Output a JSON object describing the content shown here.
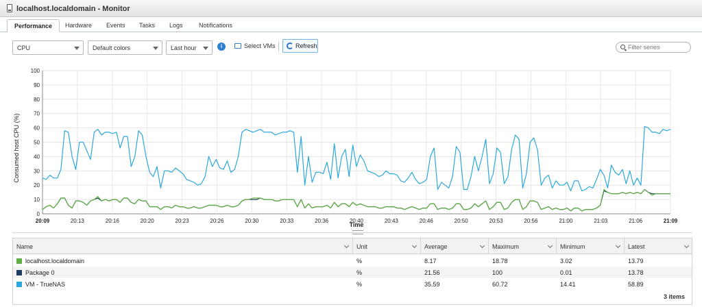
{
  "window": {
    "title": "localhost.localdomain - Monitor",
    "icon": "host-icon"
  },
  "tabs": [
    {
      "label": "Performance",
      "active": true
    },
    {
      "label": "Hardware"
    },
    {
      "label": "Events"
    },
    {
      "label": "Tasks"
    },
    {
      "label": "Logs"
    },
    {
      "label": "Notifications"
    }
  ],
  "toolbar": {
    "metric_select": "CPU",
    "colors_select": "Default colors",
    "period_select": "Last hour",
    "info_icon": "info-icon",
    "select_vms_label": "Select VMs",
    "refresh_label": "Refresh",
    "filter_placeholder": "Filter series"
  },
  "chart_data": {
    "type": "line",
    "ylabel": "Consumed host CPU (%)",
    "xlabel": "Time",
    "ylim": [
      0,
      100
    ],
    "yticks": [
      0,
      10,
      20,
      30,
      40,
      50,
      60,
      70,
      80,
      90,
      100
    ],
    "xticks": [
      "20:09",
      "20:13",
      "20:16",
      "20:20",
      "20:23",
      "20:26",
      "20:30",
      "20:33",
      "20:36",
      "20:40",
      "20:43",
      "20:46",
      "20:50",
      "20:53",
      "20:56",
      "21:00",
      "21:03",
      "21:06",
      "21:09"
    ],
    "grid": true,
    "series": [
      {
        "name": "VM - TrueNAS",
        "color": "#2aa7dc",
        "values": [
          25,
          24,
          27,
          25,
          25,
          31,
          58,
          57,
          40,
          31,
          50,
          50,
          44,
          38,
          57,
          59,
          55,
          57,
          57,
          56,
          57,
          46,
          54,
          54,
          33,
          40,
          58,
          55,
          40,
          29,
          26,
          33,
          18,
          30,
          30,
          29,
          32,
          30,
          28,
          24,
          23,
          22,
          20,
          21,
          26,
          40,
          33,
          38,
          32,
          31,
          37,
          29,
          31,
          40,
          57,
          59,
          58,
          57,
          58,
          59,
          57,
          57,
          57,
          55,
          56,
          57,
          57,
          58,
          57,
          29,
          54,
          20,
          40,
          22,
          29,
          29,
          28,
          36,
          24,
          49,
          25,
          40,
          45,
          26,
          48,
          33,
          41,
          37,
          30,
          29,
          28,
          26,
          27,
          30,
          28,
          28,
          27,
          23,
          22,
          25,
          29,
          24,
          21,
          22,
          24,
          40,
          46,
          17,
          22,
          20,
          18,
          26,
          47,
          43,
          17,
          17,
          26,
          40,
          30,
          40,
          52,
          21,
          28,
          46,
          43,
          21,
          26,
          45,
          55,
          52,
          18,
          28,
          50,
          53,
          45,
          20,
          25,
          27,
          18,
          23,
          20,
          20,
          22,
          16,
          23,
          23,
          16,
          17,
          19,
          18,
          24,
          31,
          27,
          18,
          34,
          29,
          27,
          31,
          21,
          30,
          20,
          25,
          20,
          61,
          60,
          57,
          57,
          56,
          59,
          58,
          59
        ],
        "last": 58.89
      },
      {
        "name": "Package 0",
        "color": "#1d3e63",
        "values": [
          3,
          5,
          6,
          4,
          7,
          11,
          11,
          6,
          4,
          9,
          9,
          8,
          6,
          9,
          10,
          11,
          9,
          10,
          9,
          10,
          10,
          8,
          11,
          11,
          8,
          7,
          10,
          9,
          9,
          5,
          5,
          5,
          3,
          5,
          5,
          4,
          6,
          5,
          5,
          4,
          4,
          5,
          4,
          4,
          5,
          6,
          6,
          6,
          5,
          5,
          6,
          5,
          5,
          6,
          9,
          10,
          10,
          10,
          10,
          11,
          10,
          10,
          10,
          9,
          9,
          10,
          10,
          10,
          10,
          5,
          10,
          4,
          7,
          4,
          5,
          5,
          5,
          6,
          4,
          8,
          5,
          7,
          7,
          5,
          8,
          6,
          7,
          6,
          5,
          5,
          5,
          4,
          4,
          5,
          5,
          5,
          4,
          4,
          3,
          4,
          5,
          4,
          3,
          4,
          4,
          7,
          7,
          3,
          4,
          4,
          3,
          4,
          7,
          7,
          3,
          3,
          4,
          7,
          5,
          7,
          9,
          3,
          5,
          8,
          8,
          3,
          4,
          8,
          10,
          10,
          3,
          5,
          9,
          9,
          8,
          3,
          4,
          5,
          3,
          4,
          3,
          3,
          4,
          2,
          4,
          4,
          2,
          3,
          3,
          3,
          4,
          6,
          16,
          15,
          14,
          14,
          14,
          15,
          14,
          15,
          14,
          15,
          14,
          17,
          15,
          14,
          14,
          14,
          14,
          14,
          14
        ],
        "last": 13.78
      },
      {
        "name": "localhost.localdomain",
        "color": "#5fb040",
        "values": [
          3,
          5,
          6,
          4,
          7,
          11,
          11,
          6,
          4,
          9,
          9,
          8,
          6,
          9,
          10,
          12,
          9,
          10,
          9,
          10,
          10,
          8,
          11,
          11,
          8,
          7,
          10,
          9,
          9,
          5,
          5,
          5,
          3,
          5,
          5,
          4,
          6,
          5,
          5,
          4,
          4,
          5,
          4,
          4,
          5,
          6,
          6,
          6,
          5,
          5,
          6,
          5,
          5,
          6,
          9,
          10,
          10,
          11,
          11,
          11,
          10,
          10,
          10,
          9,
          9,
          10,
          10,
          10,
          10,
          5,
          10,
          4,
          7,
          4,
          5,
          5,
          5,
          6,
          4,
          8,
          5,
          7,
          7,
          5,
          8,
          6,
          7,
          6,
          5,
          5,
          5,
          4,
          4,
          5,
          5,
          5,
          4,
          4,
          3,
          4,
          5,
          4,
          3,
          4,
          4,
          7,
          7,
          3,
          4,
          4,
          3,
          4,
          7,
          7,
          3,
          3,
          4,
          7,
          5,
          7,
          9,
          3,
          5,
          8,
          8,
          3,
          4,
          8,
          10,
          10,
          3,
          5,
          9,
          9,
          8,
          3,
          4,
          5,
          3,
          4,
          3,
          3,
          4,
          2,
          4,
          4,
          2,
          3,
          3,
          3,
          4,
          6,
          17,
          15,
          14,
          14,
          14,
          15,
          14,
          15,
          14,
          15,
          14,
          17,
          15,
          13,
          14,
          14,
          14,
          14,
          14
        ],
        "last": 13.79
      }
    ]
  },
  "table": {
    "columns": [
      "Name",
      "Unit",
      "Average",
      "Maximum",
      "Minimum",
      "Latest"
    ],
    "rows": [
      {
        "name": "localhost.localdomain",
        "color": "#5fb040",
        "unit": "%",
        "average": "8.17",
        "maximum": "18.78",
        "minimum": "3.02",
        "latest": "13.79"
      },
      {
        "name": "Package 0",
        "color": "#1d3e63",
        "unit": "%",
        "average": "21.56",
        "maximum": "100",
        "minimum": "0.01",
        "latest": "13.78"
      },
      {
        "name": "VM - TrueNAS",
        "color": "#2aa7dc",
        "unit": "%",
        "average": "35.59",
        "maximum": "60.72",
        "minimum": "14.41",
        "latest": "58.89"
      }
    ],
    "footer": "3 items"
  }
}
